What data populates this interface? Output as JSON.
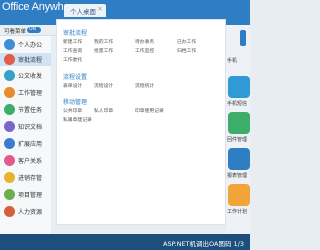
{
  "header": {
    "logo": "Office Anywhere",
    "tab_label": "个人桌面",
    "tab_close": "✕"
  },
  "subbar": {
    "menu_label": "可看菜单",
    "toggle": "ON"
  },
  "sidebar": {
    "items": [
      {
        "label": "个人办公",
        "color": "#3d8ed6"
      },
      {
        "label": "审批流程",
        "color": "#e25b4b"
      },
      {
        "label": "公文收发",
        "color": "#37a0c9"
      },
      {
        "label": "工作管理",
        "color": "#e98b2a"
      },
      {
        "label": "节置任务",
        "color": "#3cae6a"
      },
      {
        "label": "知识文档",
        "color": "#7b65c8"
      },
      {
        "label": "扩展应用",
        "color": "#3b7cd1"
      },
      {
        "label": "客户关系",
        "color": "#e25b8f"
      },
      {
        "label": "进销存管",
        "color": "#e6b42a"
      },
      {
        "label": "项目管理",
        "color": "#6ab04c"
      },
      {
        "label": "人力资源",
        "color": "#d95e3a"
      }
    ]
  },
  "panel": {
    "sections": [
      {
        "title": "审批流程",
        "items": [
          [
            "新建工作",
            "我的工作",
            "待办事务",
            "已办工作"
          ],
          [
            "工作查询",
            "批量工作",
            "工作监控",
            "归档工作"
          ],
          [
            "工作委托"
          ]
        ]
      },
      {
        "title": "流程设置",
        "items": [
          [
            "表单设计",
            "流程设计",
            "流程统计"
          ]
        ]
      },
      {
        "title": "移动管理",
        "items": [
          [
            "公共印章",
            "私人印章",
            "印章使用记录"
          ],
          [
            "私属章建记录"
          ]
        ]
      }
    ]
  },
  "right": {
    "items": [
      {
        "label": "手机",
        "color": "#3cae6a",
        "icon": "sms-icon"
      },
      {
        "label": "手机短信",
        "color": "#2f9bd6",
        "icon": "sms-icon"
      },
      {
        "label": "回件管理",
        "color": "#3cae6a",
        "icon": "mail-icon"
      },
      {
        "label": "报表管理",
        "color": "#2f7ec4",
        "icon": "report-icon"
      },
      {
        "label": "工作计划",
        "color": "#f0a43a",
        "icon": "plan-icon"
      }
    ]
  },
  "footer": {
    "text": "ASP.NET机调出OA图码  1/3"
  }
}
